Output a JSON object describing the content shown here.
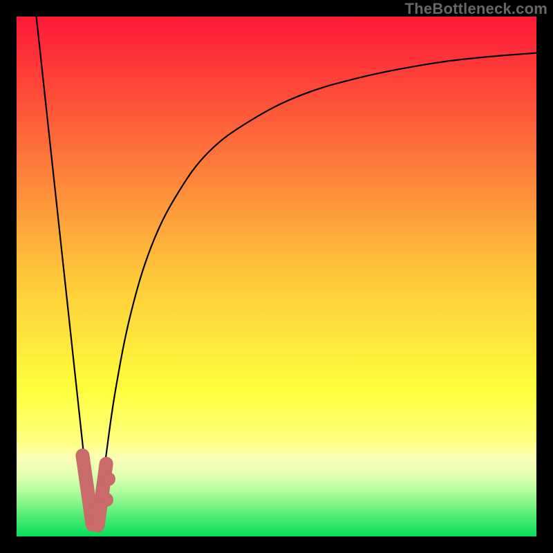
{
  "watermark": "TheBottleneck.com",
  "chart_data": {
    "type": "line",
    "title": "",
    "xlabel": "",
    "ylabel": "",
    "xlim": [
      0,
      100
    ],
    "ylim": [
      0,
      100
    ],
    "gradient_stops": [
      {
        "t": 0.0,
        "color": "#fe1837"
      },
      {
        "t": 0.25,
        "color": "#fe6f3a"
      },
      {
        "t": 0.5,
        "color": "#fec83a"
      },
      {
        "t": 0.72,
        "color": "#feff3c"
      },
      {
        "t": 0.82,
        "color": "#feff83"
      },
      {
        "t": 0.85,
        "color": "#fbffb9"
      },
      {
        "t": 0.88,
        "color": "#e3ffb3"
      },
      {
        "t": 0.91,
        "color": "#b7fd9e"
      },
      {
        "t": 0.94,
        "color": "#7cf385"
      },
      {
        "t": 0.97,
        "color": "#3ee96e"
      },
      {
        "t": 1.0,
        "color": "#07e05a"
      }
    ],
    "series": [
      {
        "name": "left-line",
        "x": [
          3.8,
          14.3
        ],
        "y": [
          100,
          3
        ]
      },
      {
        "name": "right-curve",
        "x": [
          15.5,
          17,
          19,
          22,
          26,
          31,
          37,
          45,
          55,
          67,
          80,
          90,
          100
        ],
        "y": [
          3,
          14,
          28,
          43,
          56,
          66,
          74,
          80,
          85,
          88.5,
          91,
          92.2,
          93
        ]
      }
    ],
    "marker_series": {
      "name": "bottom-cluster",
      "color": "#c86b6a",
      "left_lobe": {
        "top_x": 12.5,
        "top_y": 15.5,
        "bottom_x": 14.4,
        "bottom_y": 2.2
      },
      "right_lobe": {
        "top_x": 17.4,
        "top_y": 14.0,
        "bottom_x": 15.8,
        "bottom_y": 2.2
      },
      "extra_points": [
        {
          "x": 17.7,
          "y": 11.0
        },
        {
          "x": 17.3,
          "y": 7.0
        }
      ]
    }
  }
}
